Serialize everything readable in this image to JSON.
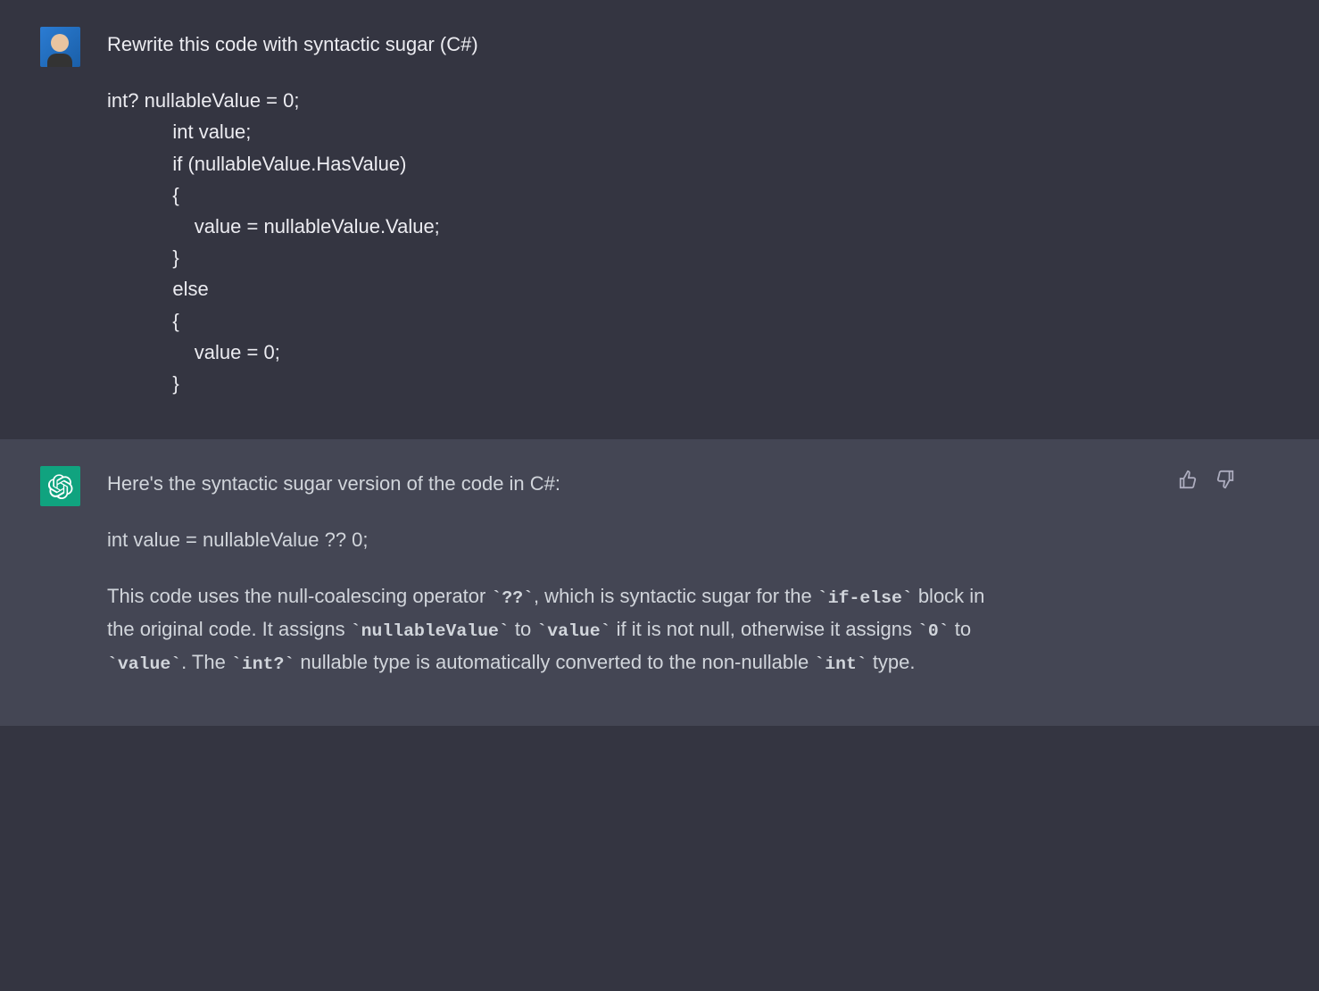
{
  "user": {
    "prompt_intro": "Rewrite this code with syntactic sugar (C#)",
    "code_line1": "int? nullableValue = 0;",
    "code_line2": "            int value;",
    "code_line3": "            if (nullableValue.HasValue)",
    "code_line4": "            {",
    "code_line5": "                value = nullableValue.Value;",
    "code_line6": "            }",
    "code_line7": "            else",
    "code_line8": "            {",
    "code_line9": "                value = 0;",
    "code_line10": "            }"
  },
  "assistant": {
    "intro": "Here's the syntactic sugar version of the code in C#:",
    "code": "int value = nullableValue ?? 0;",
    "exp_a": "This code uses the null-coalescing operator ",
    "tok_qq": "`??`",
    "exp_b": ", which is syntactic sugar for the ",
    "tok_ifelse": "`if-else`",
    "exp_c": " block in the original code. It assigns ",
    "tok_nullable": "`nullableValue`",
    "exp_d": " to ",
    "tok_value1": "`value`",
    "exp_e": " if it is not null, otherwise it assigns ",
    "tok_zero": "`0`",
    "exp_f": " to ",
    "tok_value2": "`value`",
    "exp_g": ". The ",
    "tok_intq": "`int?`",
    "exp_h": " nullable type is automatically converted to the non-nullable ",
    "tok_int": "`int`",
    "exp_i": " type."
  }
}
